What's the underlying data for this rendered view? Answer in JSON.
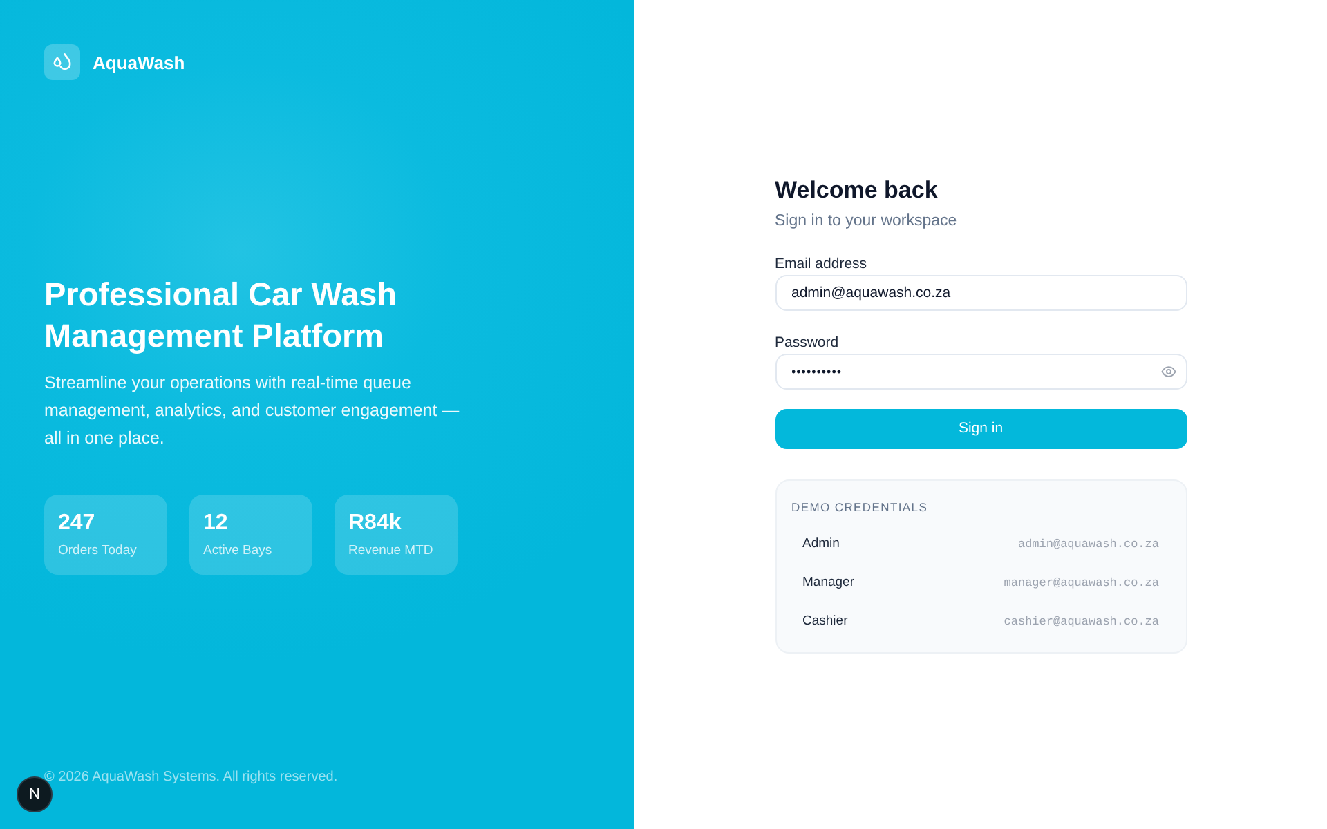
{
  "brand": {
    "name": "AquaWash"
  },
  "hero": {
    "headline": "Professional Car Wash Management Platform",
    "description": "Streamline your operations with real-time queue management, analytics, and customer engagement — all in one place."
  },
  "stats": [
    {
      "value": "247",
      "label": "Orders Today"
    },
    {
      "value": "12",
      "label": "Active Bays"
    },
    {
      "value": "R84k",
      "label": "Revenue MTD"
    }
  ],
  "footer": {
    "copyright": "© 2026 AquaWash Systems. All rights reserved."
  },
  "dev_badge": {
    "label": "N"
  },
  "login": {
    "title": "Welcome back",
    "subtitle": "Sign in to your workspace",
    "fields": [
      {
        "kind": "email",
        "label": "Email address",
        "value": "admin@aquawash.co.za"
      },
      {
        "kind": "password",
        "label": "Password",
        "value": "••••••••••"
      }
    ],
    "submit": "Sign in"
  },
  "demo_credentials": {
    "title": "DEMO CREDENTIALS",
    "accounts": [
      {
        "role": "Admin",
        "email": "admin@aquawash.co.za"
      },
      {
        "role": "Manager",
        "email": "manager@aquawash.co.za"
      },
      {
        "role": "Cashier",
        "email": "cashier@aquawash.co.za"
      }
    ]
  }
}
